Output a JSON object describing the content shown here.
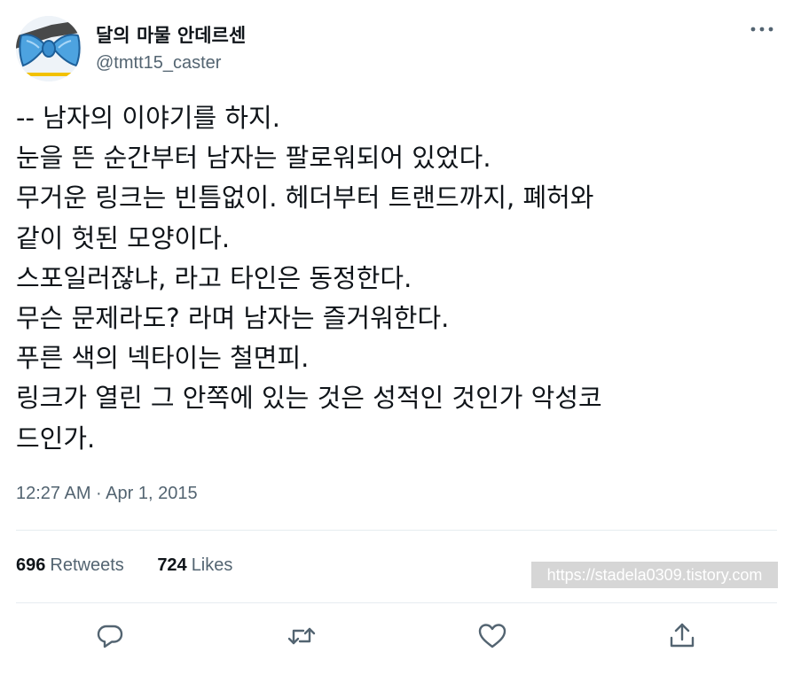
{
  "user": {
    "display_name": "달의 마물 안데르센",
    "handle": "@tmtt15_caster"
  },
  "tweet": {
    "lines": [
      "-- 남자의 이야기를 하지.",
      "눈을 뜬 순간부터 남자는 팔로워되어 있었다.",
      "무거운 링크는 빈틈없이. 헤더부터 트랜드까지, 폐허와",
      "같이 헛된 모양이다.",
      "스포일러잖냐, 라고 타인은 동정한다.",
      "무슨 문제라도? 라며 남자는 즐거워한다.",
      "푸른 색의 넥타이는 철면피.",
      "링크가 열린 그 안쪽에 있는 것은 성적인 것인가 악성코",
      "드인가."
    ],
    "timestamp": "12:27 AM · Apr 1, 2015"
  },
  "stats": {
    "retweets_count": "696",
    "retweets_label": "Retweets",
    "likes_count": "724",
    "likes_label": "Likes"
  },
  "watermark": "https://stadela0309.tistory.com",
  "actions": [
    "reply-icon",
    "retweet-icon",
    "like-icon",
    "share-icon"
  ],
  "colors": {
    "text_primary": "#0f1419",
    "text_secondary": "#536471",
    "divider": "#e6ecf0",
    "icon": "#536471"
  }
}
